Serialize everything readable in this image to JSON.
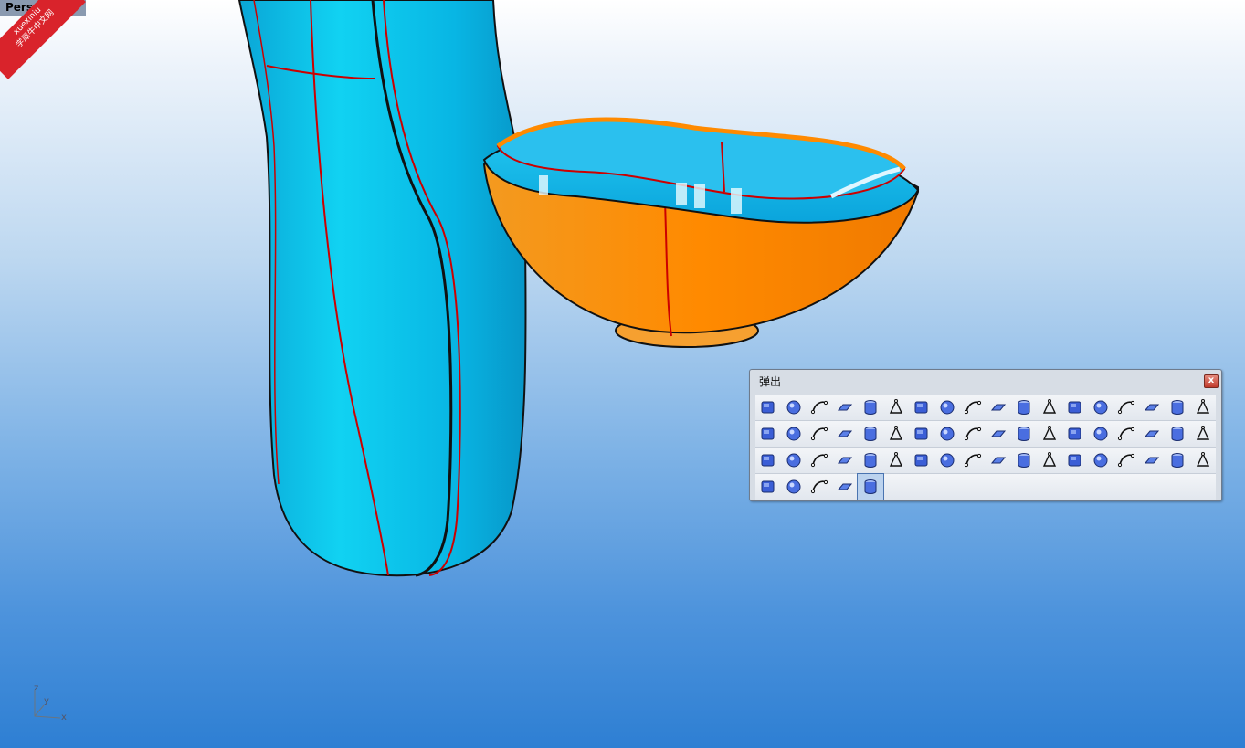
{
  "viewport": {
    "label": "Perspective"
  },
  "watermark": {
    "line1": "xuexiniu",
    "line2": "学犀牛中文网"
  },
  "axes": {
    "x": "x",
    "y": "y",
    "z": "z"
  },
  "popup": {
    "title": "弹出",
    "close_glyph": "x",
    "rows": [
      [
        "lightbulb-icon",
        "lock-icon",
        "save-icon",
        "zoom-extents-icon",
        "wireframe-sphere-icon",
        "shaded-sphere-icon",
        "color-wheel-icon",
        "gear-settings-icon",
        "explode-icon",
        "spiral-curve-icon",
        "planar-surface-icon",
        "wrap-surface-icon",
        "fan-icon",
        "curve-12-icon",
        "curve-2-icon",
        "points-circle-icon",
        "arch-icon",
        "twist-icon"
      ],
      [
        "mirror-icon",
        "array-points-icon",
        "stack-icon",
        "surface-box-icon",
        "polyline-icon",
        "circle-point-icon",
        "layers-icon",
        "cylinder-open-icon",
        "plane-surface-icon",
        "plane-surface-2-icon",
        "circle-cap-icon",
        "cube-icon",
        "sphere-icon",
        "spheres-icon",
        "sphere-intersect-icon",
        "sphere-difference-icon",
        "revolve-icon",
        "ellipsoid-icon"
      ],
      [
        "box-icon",
        "fillet-curve-icon",
        "s-curve-icon",
        "arc-curve-icon",
        "person-icon",
        "zigzag-icon",
        "vertical-bar-icon",
        "extrude-icon",
        "grid-points-icon",
        "loft-icon",
        "cylinder-icon",
        "solid-cylinder-icon",
        "revolve-solid-icon",
        "rail-revolve-icon",
        "patch-icon",
        "funnel-icon",
        "tube-icon",
        "blend-surface-icon"
      ],
      [
        "curved-plane-icon",
        "flat-plane-icon",
        "unroll-icon",
        "network-surface-icon",
        "door-panel-icon"
      ]
    ]
  }
}
